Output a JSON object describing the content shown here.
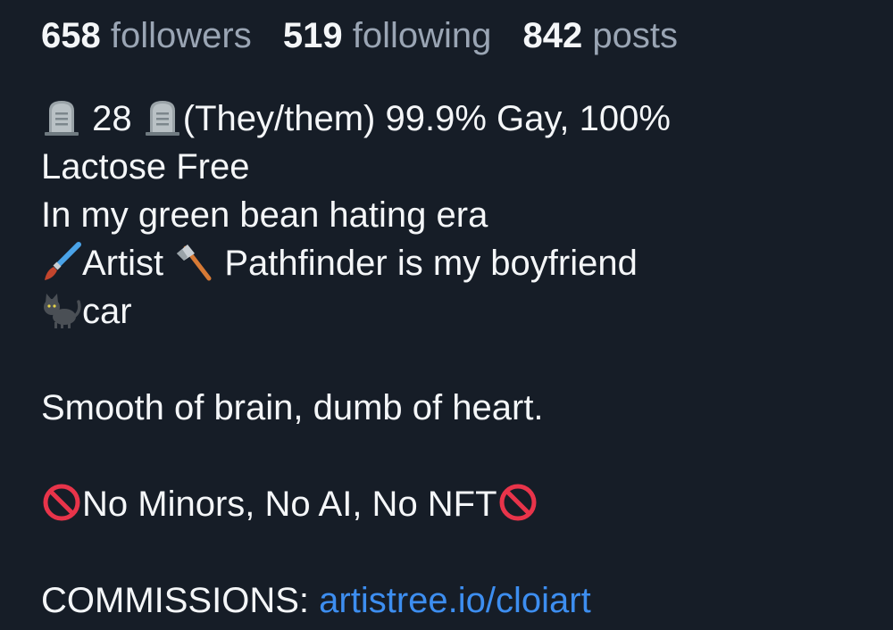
{
  "stats": [
    {
      "count": "658",
      "label": "followers"
    },
    {
      "count": "519",
      "label": "following"
    },
    {
      "count": "842",
      "label": "posts"
    }
  ],
  "bio": {
    "line1_age": "28",
    "line1_text": "(They/them) 99.9% Gay, 100%",
    "line2": "Lactose Free",
    "line3": "In my green bean hating era",
    "line4_artist": "Artist",
    "line4_text": "Pathfinder is my boyfriend",
    "line5": "car",
    "line6": "Smooth of brain, dumb of heart.",
    "line7": "No Minors, No AI, No NFT",
    "commissions_label": "COMMISSIONS:",
    "commissions_link": "artistree.io/cloiart"
  },
  "icons": {
    "tombstone": "headstone-icon",
    "brush": "paintbrush-icon",
    "axe": "axe-icon",
    "cat": "black-cat-icon",
    "prohibited": "no-entry-sign-icon"
  },
  "colors": {
    "background": "#161d27",
    "text": "#f4f6f8",
    "muted": "#9aa5b4",
    "link": "#3d8ef0",
    "prohibited": "#e8344a"
  }
}
